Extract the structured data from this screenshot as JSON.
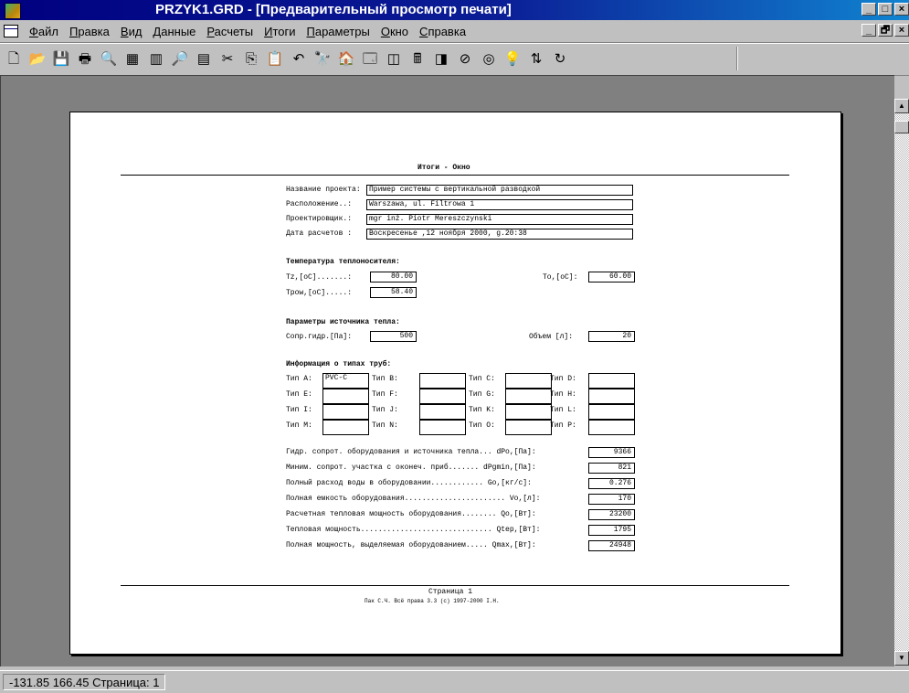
{
  "window": {
    "title": "PRZYK1.GRD - [Предварительный просмотр печати]",
    "caption_buttons": [
      "_",
      "□",
      "×"
    ],
    "mdi_buttons": [
      "_",
      "🗗",
      "×"
    ]
  },
  "menu": {
    "items": [
      "Файл",
      "Правка",
      "Вид",
      "Данные",
      "Расчеты",
      "Итоги",
      "Параметры",
      "Окно",
      "Справка"
    ]
  },
  "toolbar": {
    "buttons": [
      {
        "icon": "new-document-icon",
        "glyph": "🗋"
      },
      {
        "icon": "open-folder-icon",
        "glyph": "📂"
      },
      {
        "icon": "save-icon",
        "glyph": "💾"
      },
      {
        "icon": "print-icon",
        "glyph": "🖶"
      },
      {
        "icon": "print-preview-icon",
        "glyph": "🔍"
      },
      {
        "icon": "grid-data-icon",
        "glyph": "▦"
      },
      {
        "icon": "table-icon",
        "glyph": "▥"
      },
      {
        "icon": "zoom-icon",
        "glyph": "🔎"
      },
      {
        "icon": "sheet-icon",
        "glyph": "▤"
      },
      {
        "icon": "cut-icon",
        "glyph": "✂"
      },
      {
        "icon": "copy-icon",
        "glyph": "⎘"
      },
      {
        "icon": "paste-icon",
        "glyph": "📋"
      },
      {
        "icon": "undo-icon",
        "glyph": "↶"
      },
      {
        "icon": "find-icon",
        "glyph": "🔭"
      },
      {
        "icon": "home-icon",
        "glyph": "🏠"
      },
      {
        "icon": "window-icon",
        "glyph": "🗔"
      },
      {
        "icon": "columns-icon",
        "glyph": "◫"
      },
      {
        "icon": "calculator-icon",
        "glyph": "🖩"
      },
      {
        "icon": "columns-alt-icon",
        "glyph": "◨"
      },
      {
        "icon": "stop-icon",
        "glyph": "⊘"
      },
      {
        "icon": "target-icon",
        "glyph": "◎"
      },
      {
        "icon": "bulb-icon",
        "glyph": "💡"
      },
      {
        "icon": "flip-icon",
        "glyph": "⇅"
      },
      {
        "icon": "rotate-icon",
        "glyph": "↻"
      }
    ]
  },
  "page": {
    "title": "Итоги - Окно",
    "project": {
      "labels": [
        "Название проекта:",
        "Расположение..:",
        "Проектировщик.:",
        "Дата расчетов :"
      ],
      "values": [
        "Пример системы с вертикальной разводкой",
        "Warszawa, ul. Filtrowa 1",
        "mgr inż. Piotr Mereszczynski",
        "Воскресенье ,12 ноября 2000, g.20:38"
      ]
    },
    "temps": {
      "heading": "Температура теплоносителя:",
      "tz_label": "Tz,[oC].......:",
      "tz_value": "80.00",
      "tpow_label": "Tpow,[oC].....:",
      "tpow_value": "58.40",
      "to_label": "To,[oC]:",
      "to_value": "60.00"
    },
    "source": {
      "heading": "Параметры источника тепла:",
      "resist_label": "Сопр.гидр.[Па]:",
      "resist_value": "500",
      "volume_label": "Объем [л]:",
      "volume_value": "20"
    },
    "pipes": {
      "heading": "Информация о типах труб:",
      "rows": [
        [
          {
            "label": "Тип A:",
            "value": "PVC-C"
          },
          {
            "label": "Тип B:",
            "value": ""
          },
          {
            "label": "Тип C:",
            "value": ""
          },
          {
            "label": "Тип D:",
            "value": ""
          }
        ],
        [
          {
            "label": "Тип E:",
            "value": ""
          },
          {
            "label": "Тип F:",
            "value": ""
          },
          {
            "label": "Тип G:",
            "value": ""
          },
          {
            "label": "Тип H:",
            "value": ""
          }
        ],
        [
          {
            "label": "Тип I:",
            "value": ""
          },
          {
            "label": "Тип J:",
            "value": ""
          },
          {
            "label": "Тип K:",
            "value": ""
          },
          {
            "label": "Тип L:",
            "value": ""
          }
        ],
        [
          {
            "label": "Тип M:",
            "value": ""
          },
          {
            "label": "Тип N:",
            "value": ""
          },
          {
            "label": "Тип O:",
            "value": ""
          },
          {
            "label": "Тип P:",
            "value": ""
          }
        ]
      ]
    },
    "results": {
      "labels": [
        "Гидр. сопрот. оборудования и источника тепла... dPo,[Па]:",
        "Миним. сопрот. участка с оконеч. приб....... dPgmin,[Па]:",
        "Полный расход воды в оборудовании............ Go,[кг/с]:",
        "Полная емкость оборудования....................... Vo,[л]:",
        "Расчетная тепловая мощность оборудования........ Qo,[Вт]:",
        "Тепловая мощность.............................. Qtep,[Вт]:",
        "Полная мощность, выделяемая оборудованием..... Qmax,[Вт]:"
      ],
      "values": [
        "9366",
        "821",
        "0.276",
        "170",
        "23200",
        "1795",
        "24948"
      ]
    },
    "footer": {
      "page_label": "Страница 1",
      "credits": "Пак C.Ч. Всё права 3.3 (c) 1997-2000 I.H."
    }
  },
  "status": {
    "coords": "-131.85  166.45",
    "page": "Страница: 1"
  }
}
